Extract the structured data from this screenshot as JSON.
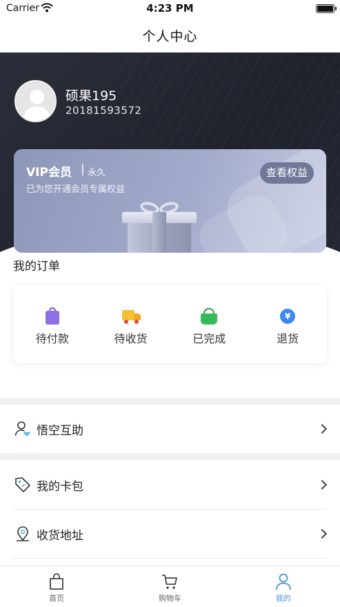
{
  "status_bar": {
    "carrier": "Carrier",
    "time": "4:23 PM"
  },
  "nav": {
    "title": "个人中心"
  },
  "profile": {
    "name": "硕果195",
    "user_id": "20181593572"
  },
  "vip": {
    "title": "VIP会员",
    "separator": "|",
    "term": "永久",
    "description": "已为您开通会员专属权益",
    "button_label": "查看权益"
  },
  "orders": {
    "title": "我的订单",
    "items": [
      {
        "label": "待付款",
        "icon": "purple-bag-icon"
      },
      {
        "label": "待收货",
        "icon": "truck-icon"
      },
      {
        "label": "已完成",
        "icon": "green-basket-icon"
      },
      {
        "label": "退货",
        "icon": "yen-coin-icon"
      }
    ]
  },
  "menu": {
    "items": [
      {
        "label": "悟空互助",
        "icon": "user-heart-icon"
      },
      {
        "label": "我的卡包",
        "icon": "tag-icon"
      },
      {
        "label": "收货地址",
        "icon": "location-pin-icon"
      }
    ]
  },
  "tab_bar": {
    "items": [
      {
        "label": "首页",
        "icon": "home-bag-icon",
        "active": false
      },
      {
        "label": "购物车",
        "icon": "cart-icon",
        "active": false
      },
      {
        "label": "我的",
        "icon": "person-icon",
        "active": true
      }
    ],
    "active_color": "#4a90e2"
  }
}
